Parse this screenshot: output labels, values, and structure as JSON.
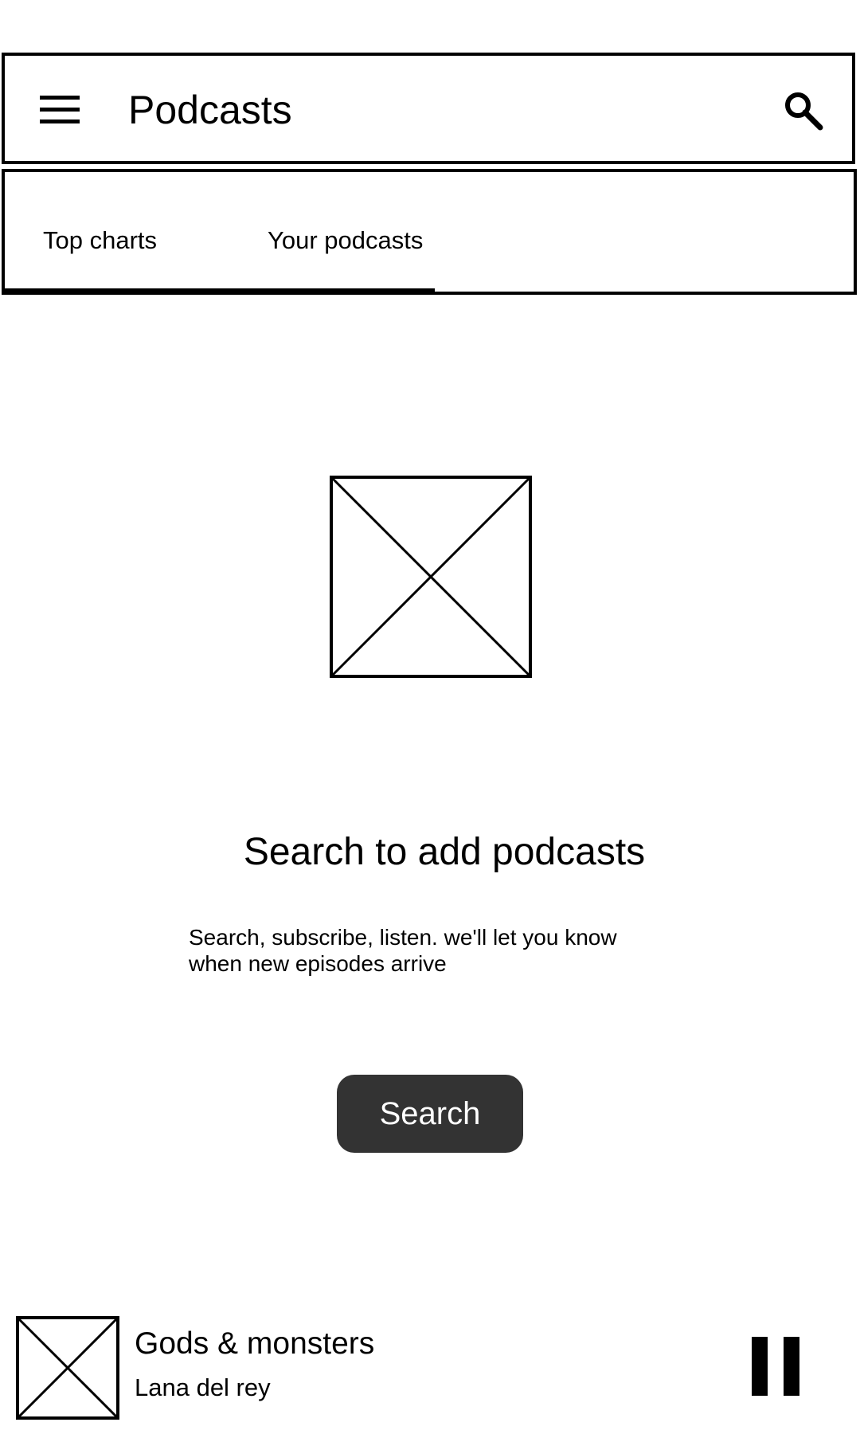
{
  "app_bar": {
    "title": "Podcasts",
    "menu_icon": "hamburger-menu-icon",
    "search_icon": "search-icon"
  },
  "tabs": [
    {
      "label": "Top charts",
      "selected": false
    },
    {
      "label": "Your podcasts",
      "selected": true
    }
  ],
  "empty_state": {
    "image_icon": "image-placeholder-icon",
    "title": "Search to add podcasts",
    "description_line1": "Search, subscribe, listen. we'll let you know",
    "description_line2": "when new episodes arrive",
    "button_label": "Search"
  },
  "now_playing": {
    "title": "Gods & monsters",
    "artist": "Lana del rey",
    "artwork_icon": "image-placeholder-icon",
    "control_icon": "pause-icon"
  },
  "colors": {
    "button_background": "#333333",
    "button_text": "#ffffff",
    "outline": "#000000"
  }
}
